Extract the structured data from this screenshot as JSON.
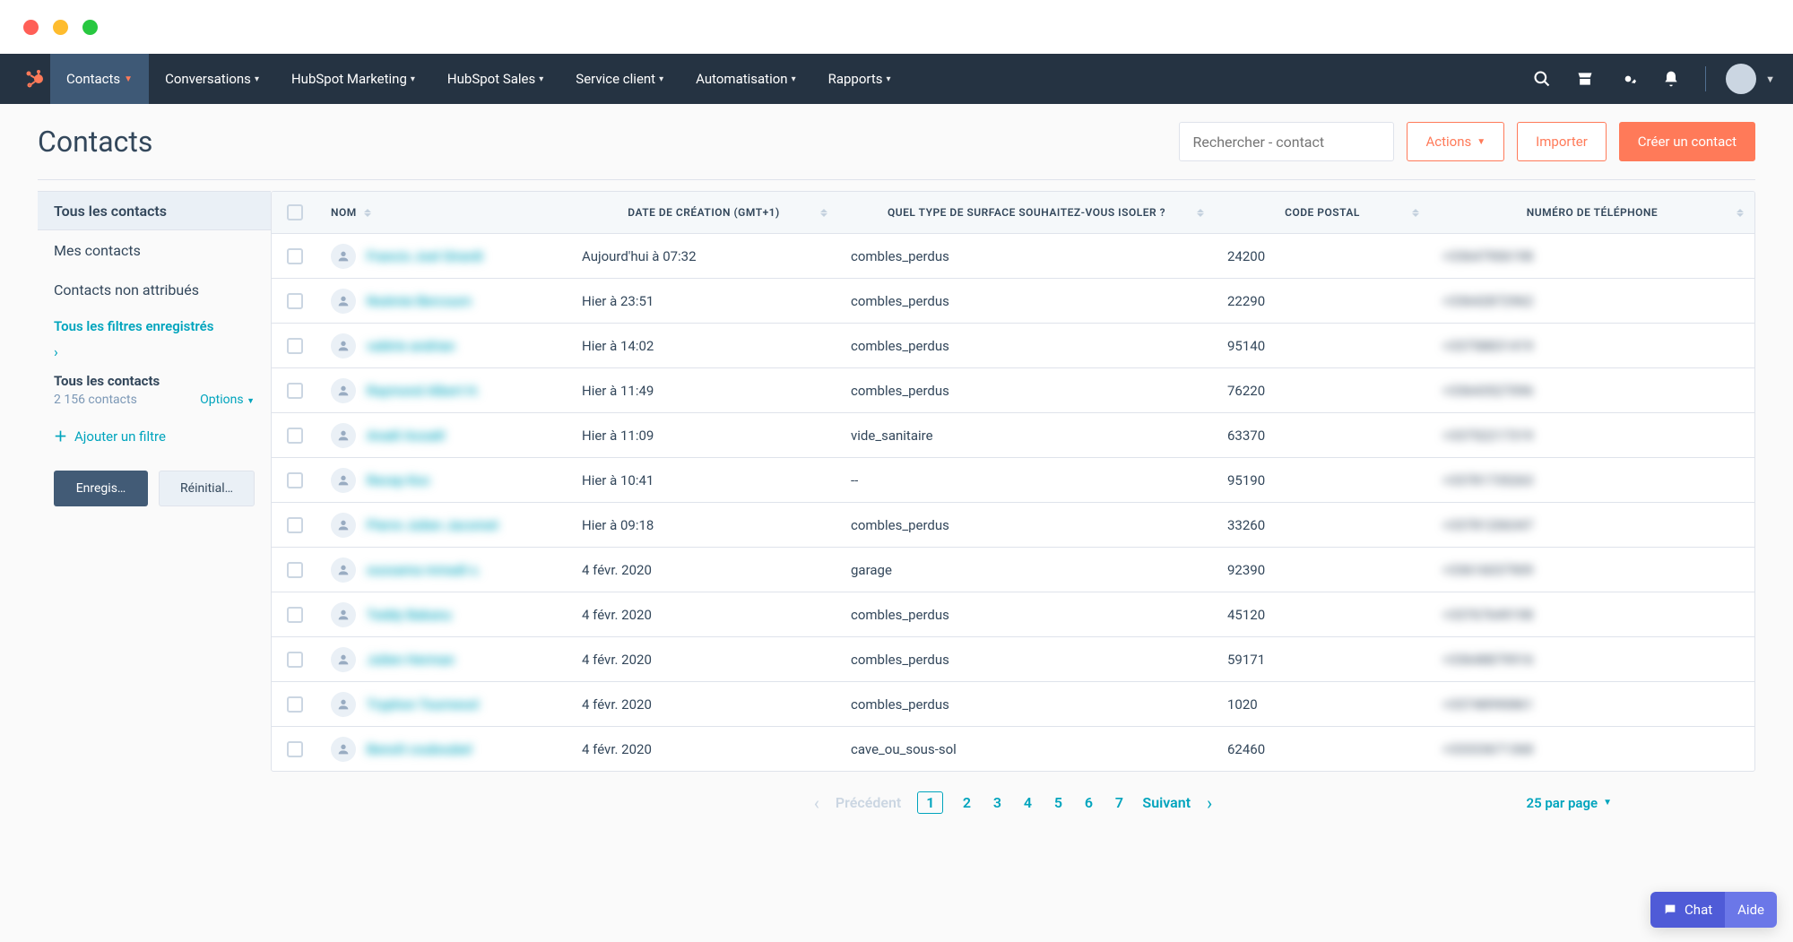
{
  "nav": {
    "items": [
      {
        "label": "Contacts",
        "active": true
      },
      {
        "label": "Conversations"
      },
      {
        "label": "HubSpot Marketing"
      },
      {
        "label": "HubSpot Sales"
      },
      {
        "label": "Service client"
      },
      {
        "label": "Automatisation"
      },
      {
        "label": "Rapports"
      }
    ]
  },
  "page": {
    "title": "Contacts",
    "search_placeholder": "Rechercher - contact",
    "actions": "Actions",
    "import": "Importer",
    "create": "Créer un contact"
  },
  "sidebar": {
    "items": [
      "Tous les contacts",
      "Mes contacts",
      "Contacts non attribués"
    ],
    "all_filters": "Tous les filtres enregistrés",
    "sub_title": "Tous les contacts",
    "count": "2 156 contacts",
    "options": "Options",
    "add_filter": "Ajouter un filtre",
    "save": "Enregis…",
    "reset": "Réinitial…"
  },
  "table": {
    "headers": {
      "name": "NOM",
      "date": "DATE DE CRÉATION (GMT+1)",
      "type": "QUEL TYPE DE SURFACE SOUHAITEZ-VOUS ISOLER ?",
      "zip": "CODE POSTAL",
      "phone": "NUMÉRO DE TÉLÉPHONE"
    },
    "rows": [
      {
        "name": "Francis Joel Girardi",
        "date": "Aujourd'hui à 07:32",
        "type": "combles_perdus",
        "zip": "24200",
        "phone": "+33647906198"
      },
      {
        "name": "Noémie Bercourn",
        "date": "Hier à 23:51",
        "type": "combles_perdus",
        "zip": "22290",
        "phone": "+33642872962"
      },
      {
        "name": "valérie andrian",
        "date": "Hier à 14:02",
        "type": "combles_perdus",
        "zip": "95140",
        "phone": "+33758831419"
      },
      {
        "name": "Raymond Albert H.",
        "date": "Hier à 11:49",
        "type": "combles_perdus",
        "zip": "76220",
        "phone": "+33643527096"
      },
      {
        "name": "Anaël Assaël",
        "date": "Hier à 11:09",
        "type": "vide_sanitaire",
        "zip": "63370",
        "phone": "+33752217319"
      },
      {
        "name": "Recep Koc",
        "date": "Hier à 10:41",
        "type": "--",
        "zip": "95190",
        "phone": "+33781735263"
      },
      {
        "name": "Pierre Julien Jacomet",
        "date": "Hier à 09:18",
        "type": "combles_perdus",
        "zip": "33260",
        "phone": "+33781206347"
      },
      {
        "name": "oussama mmadi s.",
        "date": "4 févr. 2020",
        "type": "garage",
        "zip": "92390",
        "phone": "+33616037909"
      },
      {
        "name": "Teddy Bakanu",
        "date": "4 févr. 2020",
        "type": "combles_perdus",
        "zip": "45120",
        "phone": "+33767649198"
      },
      {
        "name": "Julien Herman",
        "date": "4 févr. 2020",
        "type": "combles_perdus",
        "zip": "59171",
        "phone": "+33648879916"
      },
      {
        "name": "Tryphon Tournesol",
        "date": "4 févr. 2020",
        "type": "combles_perdus",
        "zip": "1020",
        "phone": "+33748990861"
      },
      {
        "name": "Benoît couboubel",
        "date": "4 févr. 2020",
        "type": "cave_ou_sous-sol",
        "zip": "62460",
        "phone": "+33333671368"
      }
    ]
  },
  "pager": {
    "prev": "Précédent",
    "pages": [
      "1",
      "2",
      "3",
      "4",
      "5",
      "6",
      "7"
    ],
    "next": "Suivant",
    "per_page": "25 par page"
  },
  "help": {
    "chat": "Chat",
    "aide": "Aide"
  }
}
